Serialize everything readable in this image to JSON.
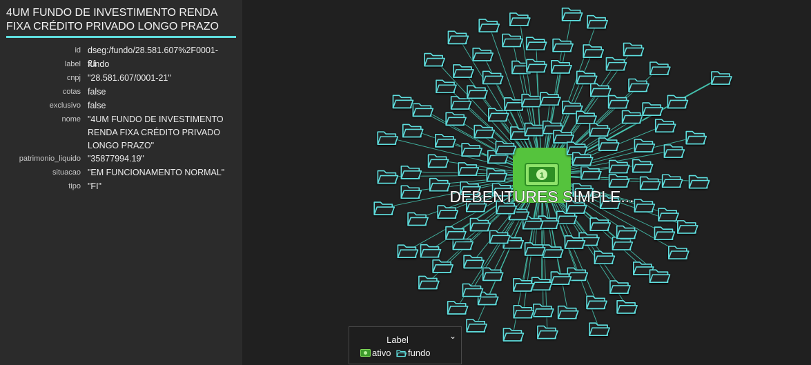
{
  "node_title": "4UM FUNDO DE INVESTIMENTO RENDA FIXA CRÉDITO PRIVADO LONGO PRAZO",
  "properties": [
    {
      "key": "id",
      "value": "dseg:/fundo/28.581.607%2F0001-21"
    },
    {
      "key": "label",
      "value": "fundo"
    },
    {
      "key": "cnpj",
      "value": "\"28.581.607/0001-21\""
    },
    {
      "key": "cotas",
      "value": "false"
    },
    {
      "key": "exclusivo",
      "value": "false"
    },
    {
      "key": "nome",
      "value": "\"4UM FUNDO DE INVESTIMENTO RENDA FIXA CRÉDITO PRIVADO LONGO PRAZO\""
    },
    {
      "key": "patrimonio_liquido",
      "value": "\"35877994.19\""
    },
    {
      "key": "situacao",
      "value": "\"EM FUNCIONAMENTO NORMAL\""
    },
    {
      "key": "tipo",
      "value": "\"FI\""
    }
  ],
  "graph": {
    "center_node": {
      "label": "DEBENTURES SIMPLE...",
      "type": "ativo",
      "icon": "banknote-icon"
    },
    "neighbor_type": "fundo",
    "neighbor_icon": "folder-icon",
    "highlighted_neighbor_icon": "folder-icon"
  },
  "legend": {
    "title": "Label",
    "toggle_icon": "chevron-down-icon",
    "items": [
      {
        "label": "ativo",
        "icon": "banknote-icon",
        "color": "#7ed957"
      },
      {
        "label": "fundo",
        "icon": "folder-icon",
        "color": "#5fdede"
      }
    ]
  },
  "colors": {
    "fundo": "#5fdede",
    "ativo": "#55c33d",
    "ativo_dark": "#2e8f24",
    "edge": "#47c9b4",
    "accent": "#5fdede"
  }
}
